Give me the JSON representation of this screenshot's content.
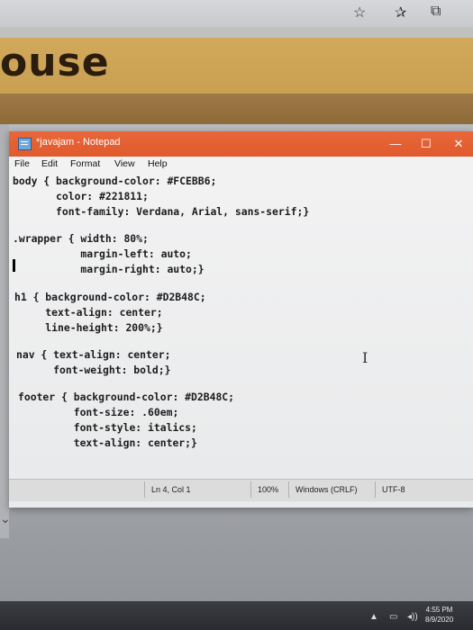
{
  "browser": {
    "icons": [
      "star-icon",
      "favorites-icon",
      "collections-icon"
    ],
    "star_glyph": "☆",
    "favorites_glyph": "✰",
    "collections_glyph": "⧉"
  },
  "webpage": {
    "title_fragment": "ouse",
    "colors": {
      "yellow": "#D2A85A",
      "brown": "#8E6A3A"
    }
  },
  "notepad": {
    "title": "*javajam - Notepad",
    "window_buttons": {
      "minimize": "—",
      "maximize": "☐",
      "close": "✕"
    },
    "menu": [
      "File",
      "Edit",
      "Format",
      "View",
      "Help"
    ],
    "code_lines": [
      "body { background-color: #FCEBB6;",
      "       color: #221811;",
      "       font-family: Verdana, Arial, sans-serif;}",
      "",
      ".wrapper { width: 80%;",
      "           margin-left: auto;",
      "           margin-right: auto;}",
      "",
      "h1 { background-color: #D2B48C;",
      "     text-align: center;",
      "     line-height: 200%;}",
      "",
      "nav { text-align: center;",
      "      font-weight: bold;}",
      "",
      "footer { background-color: #D2B48C;",
      "         font-size: .60em;",
      "         font-style: italics;",
      "         text-align: center;}"
    ],
    "status": {
      "position": "Ln 4, Col 1",
      "zoom": "100%",
      "line_endings": "Windows (CRLF)",
      "encoding": "UTF-8"
    },
    "accent_color": "#E05A2D"
  },
  "taskbar": {
    "time": "4:55 PM",
    "date": "8/9/2020"
  }
}
